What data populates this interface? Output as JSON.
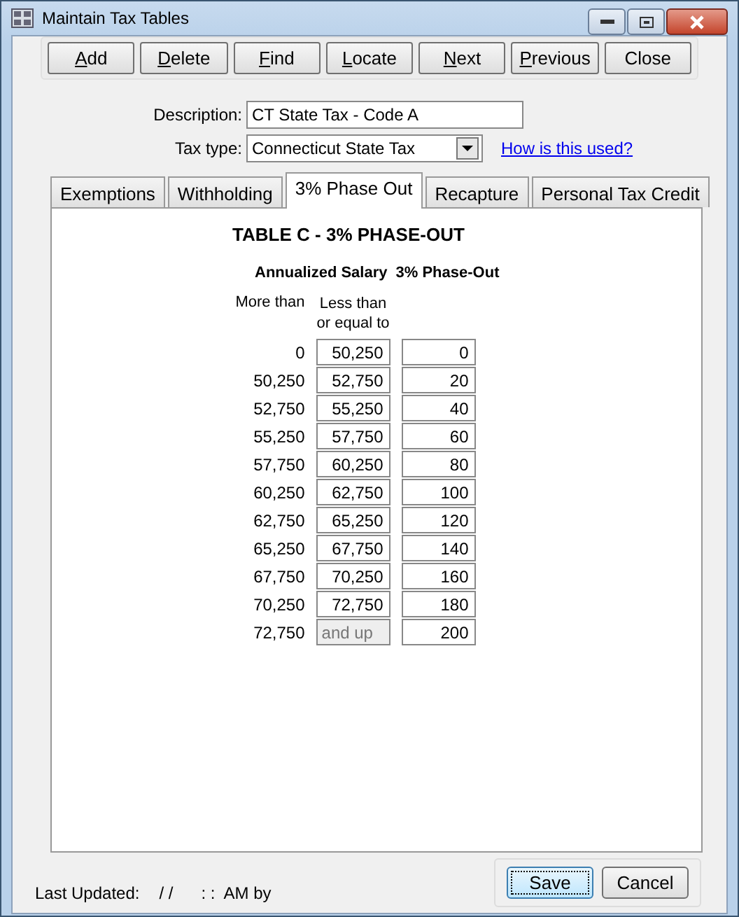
{
  "window": {
    "title": "Maintain Tax Tables"
  },
  "toolbar": [
    {
      "label": "Add",
      "mnemonic": true
    },
    {
      "label": "Delete",
      "mnemonic": true
    },
    {
      "label": "Find",
      "mnemonic": true
    },
    {
      "label": "Locate",
      "mnemonic": true
    },
    {
      "label": "Next",
      "mnemonic": true
    },
    {
      "label": "Previous",
      "mnemonic": true
    },
    {
      "label": "Close",
      "mnemonic": false
    }
  ],
  "description": {
    "label": "Description:",
    "value": "CT State Tax - Code A"
  },
  "tax_type": {
    "label": "Tax type:",
    "value": "Connecticut State Tax",
    "help_link": "How is this used?"
  },
  "tabs": [
    {
      "label": "Exemptions",
      "selected": false
    },
    {
      "label": "Withholding",
      "selected": false
    },
    {
      "label": "3% Phase Out",
      "selected": true
    },
    {
      "label": "Recapture",
      "selected": false
    },
    {
      "label": "Personal Tax Credit",
      "selected": false
    }
  ],
  "table": {
    "title": "TABLE C - 3% PHASE-OUT",
    "group_heading": "Annualized Salary",
    "value_heading": "3% Phase-Out",
    "col_more": "More than",
    "col_less": "Less than or equal to",
    "rows": [
      {
        "more_than": "0",
        "less_than": "50,250",
        "phase_out": "0"
      },
      {
        "more_than": "50,250",
        "less_than": "52,750",
        "phase_out": "20"
      },
      {
        "more_than": "52,750",
        "less_than": "55,250",
        "phase_out": "40"
      },
      {
        "more_than": "55,250",
        "less_than": "57,750",
        "phase_out": "60"
      },
      {
        "more_than": "57,750",
        "less_than": "60,250",
        "phase_out": "80"
      },
      {
        "more_than": "60,250",
        "less_than": "62,750",
        "phase_out": "100"
      },
      {
        "more_than": "62,750",
        "less_than": "65,250",
        "phase_out": "120"
      },
      {
        "more_than": "65,250",
        "less_than": "67,750",
        "phase_out": "140"
      },
      {
        "more_than": "67,750",
        "less_than": "70,250",
        "phase_out": "160"
      },
      {
        "more_than": "70,250",
        "less_than": "72,750",
        "phase_out": "180"
      },
      {
        "more_than": "72,750",
        "less_than": "and up",
        "less_disabled": true,
        "phase_out": "200"
      }
    ]
  },
  "status": {
    "label": "Last Updated:",
    "date": "/ /",
    "time": ": :",
    "suffix": "AM by"
  },
  "buttons": [
    {
      "label": "Save",
      "default": true
    },
    {
      "label": "Cancel",
      "default": false
    }
  ]
}
